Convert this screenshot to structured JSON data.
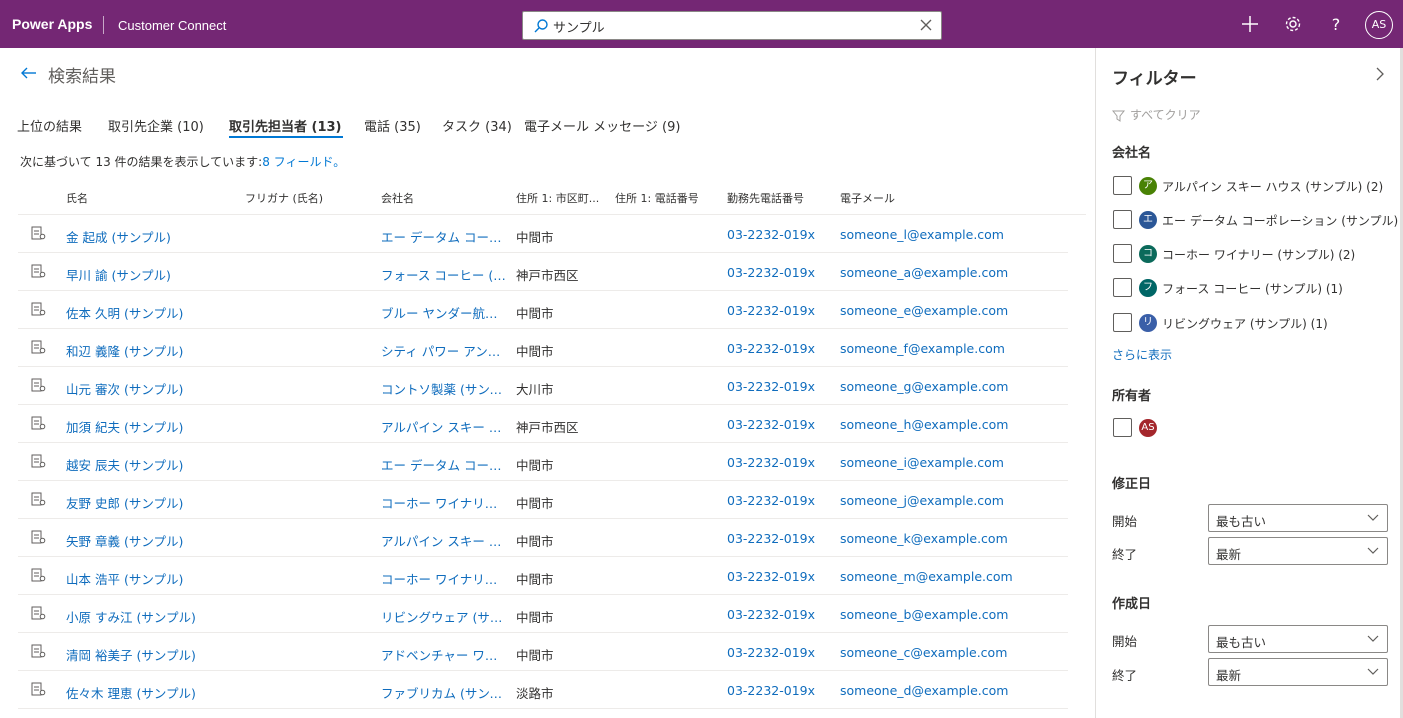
{
  "header": {
    "app_name": "Power Apps",
    "env_name": "Customer Connect",
    "search_value": "サンプル",
    "avatar": "AS"
  },
  "page": {
    "title": "検索結果",
    "tabs": [
      {
        "label": "上位の結果"
      },
      {
        "label": "取引先企業 (10)"
      },
      {
        "label": "取引先担当者 (13)",
        "active": true
      },
      {
        "label": "電話 (35)"
      },
      {
        "label": "タスク (34)"
      },
      {
        "label": "電子メール メッセージ (9)"
      }
    ],
    "result_info": "次に基づいて 13 件の結果を表示しています:",
    "result_info_link": "8 フィールド。"
  },
  "grid": {
    "columns": [
      "氏名",
      "フリガナ (氏名)",
      "会社名",
      "住所 1: 市区町...",
      "住所 1: 電話番号",
      "勤務先電話番号",
      "電子メール"
    ],
    "rows": [
      {
        "name": "金 起成 (サンプル)",
        "company": "エー データム コーポレ...",
        "city": "中間市",
        "phone": "03-2232-019x",
        "email": "someone_l@example.com"
      },
      {
        "name": "早川 諭 (サンプル)",
        "company": "フォース コーヒー (サン...",
        "city": "神戸市西区",
        "phone": "03-2232-019x",
        "email": "someone_a@example.com"
      },
      {
        "name": "佐本 久明 (サンプル)",
        "company": "ブルー ヤンダー航空 ...",
        "city": "中間市",
        "phone": "03-2232-019x",
        "email": "someone_e@example.com"
      },
      {
        "name": "和辺 義隆 (サンプル)",
        "company": "シティ パワー アンド ...",
        "city": "中間市",
        "phone": "03-2232-019x",
        "email": "someone_f@example.com"
      },
      {
        "name": "山元 審次 (サンプル)",
        "company": "コントソ製薬 (サンプ...",
        "city": "大川市",
        "phone": "03-2232-019x",
        "email": "someone_g@example.com"
      },
      {
        "name": "加須 紀夫 (サンプル)",
        "company": "アルパイン スキー ハ...",
        "city": "神戸市西区",
        "phone": "03-2232-019x",
        "email": "someone_h@example.com"
      },
      {
        "name": "越安 辰夫 (サンプル)",
        "company": "エー データム コーポレ...",
        "city": "中間市",
        "phone": "03-2232-019x",
        "email": "someone_i@example.com"
      },
      {
        "name": "友野 史郎 (サンプル)",
        "company": "コーホー ワイナリー (...",
        "city": "中間市",
        "phone": "03-2232-019x",
        "email": "someone_j@example.com"
      },
      {
        "name": "矢野 章義 (サンプル)",
        "company": "アルパイン スキー ハ...",
        "city": "中間市",
        "phone": "03-2232-019x",
        "email": "someone_k@example.com"
      },
      {
        "name": "山本 浩平 (サンプル)",
        "company": "コーホー ワイナリー (...",
        "city": "中間市",
        "phone": "03-2232-019x",
        "email": "someone_m@example.com"
      },
      {
        "name": "小原 すみ江 (サンプル)",
        "company": "リビングウェア (サン...",
        "city": "中間市",
        "phone": "03-2232-019x",
        "email": "someone_b@example.com"
      },
      {
        "name": "清岡 裕美子 (サンプル)",
        "company": "アドベンチャー ワーク...",
        "city": "中間市",
        "phone": "03-2232-019x",
        "email": "someone_c@example.com"
      },
      {
        "name": "佐々木 理恵 (サンプル)",
        "company": "ファブリカム (サンプル)",
        "city": "淡路市",
        "phone": "03-2232-019x",
        "email": "someone_d@example.com"
      }
    ]
  },
  "filter": {
    "title": "フィルター",
    "clear_all": "すべてクリア",
    "company_label": "会社名",
    "companies": [
      {
        "initial": "ア",
        "label": "アルパイン スキー ハウス (サンプル) (2)",
        "color": "#498205"
      },
      {
        "initial": "エ",
        "label": "エー データム コーポレーション (サンプル) (2)",
        "color": "#2b5797"
      },
      {
        "initial": "コ",
        "label": "コーホー ワイナリー (サンプル) (2)",
        "color": "#0b6a5b"
      },
      {
        "initial": "フ",
        "label": "フォース コーヒー (サンプル) (1)",
        "color": "#006666"
      },
      {
        "initial": "リ",
        "label": "リビングウェア (サンプル) (1)",
        "color": "#3a5fa8"
      }
    ],
    "show_more": "さらに表示",
    "owner_label": "所有者",
    "owner_initials": "AS",
    "owner_color": "#a4262c",
    "modified_label": "修正日",
    "created_label": "作成日",
    "start_label": "開始",
    "end_label": "終了",
    "oldest": "最も古い",
    "newest": "最新"
  },
  "colors": {
    "header_bg": "#742774",
    "link": "#0f6cbd",
    "accent": "#0078d4"
  }
}
